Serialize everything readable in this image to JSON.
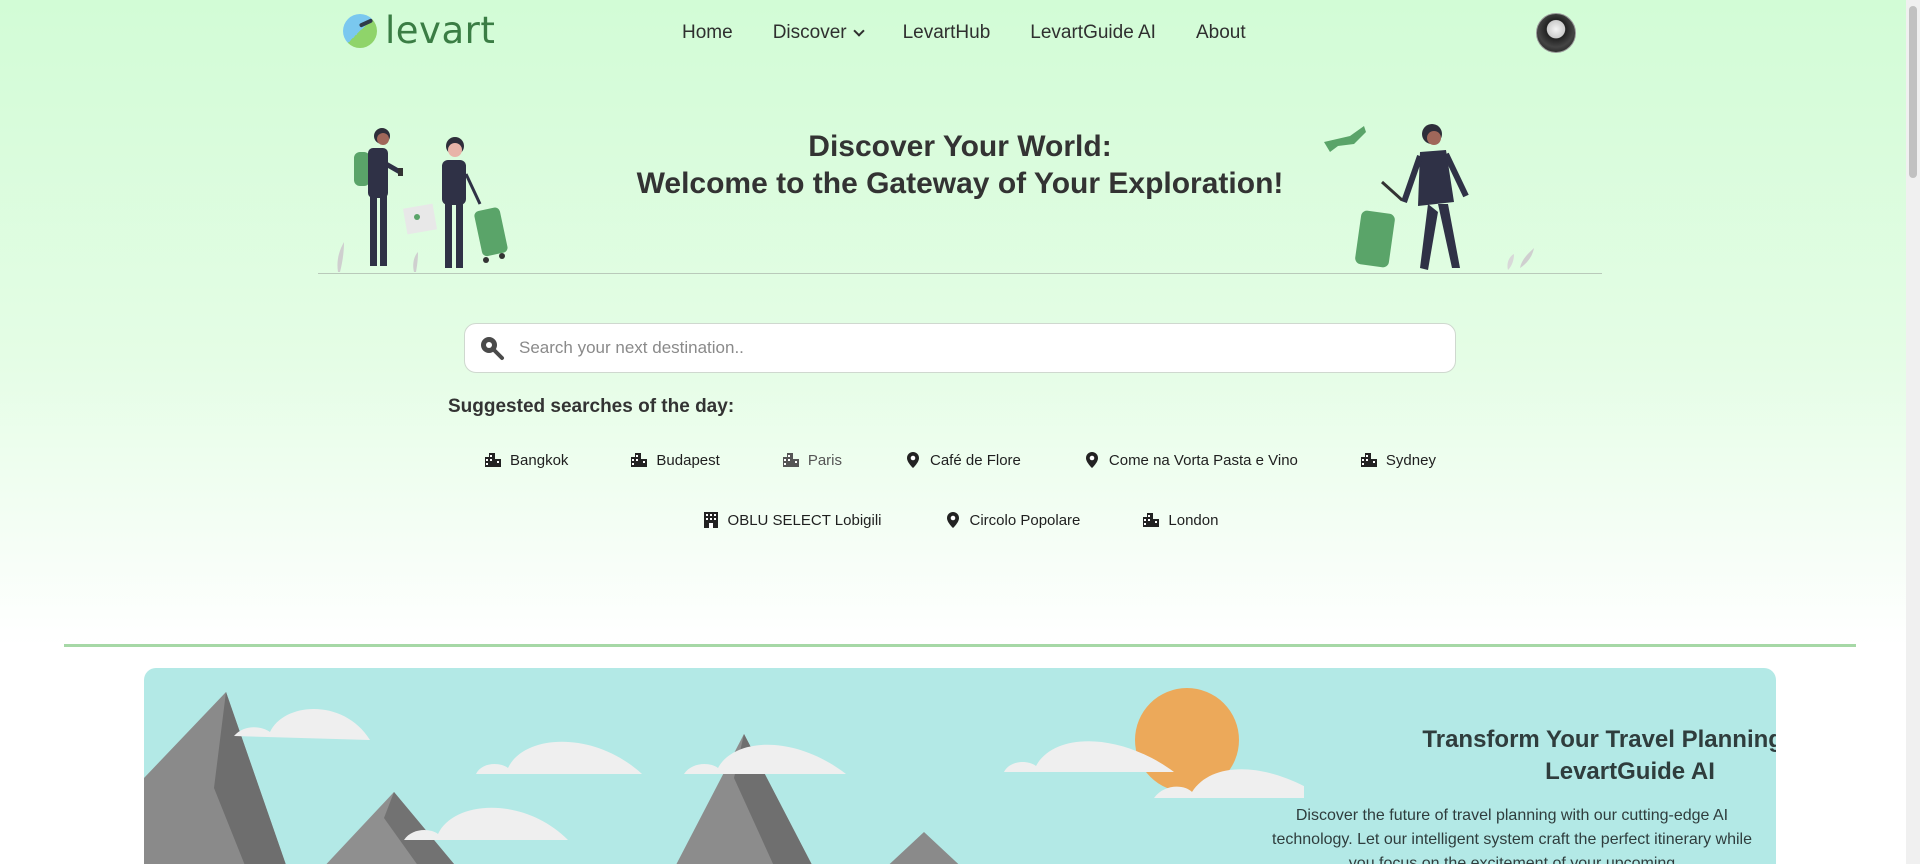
{
  "nav": {
    "logo_text": "levart",
    "links": [
      {
        "label": "Home"
      },
      {
        "label": "Discover"
      },
      {
        "label": "LevartHub"
      },
      {
        "label": "LevartGuide AI"
      },
      {
        "label": "About"
      }
    ]
  },
  "hero": {
    "title_line1": "Discover Your World:",
    "title_line2": "Welcome to the Gateway of Your Exploration!"
  },
  "search": {
    "placeholder": "Search your next destination..",
    "value": ""
  },
  "suggestions": {
    "title": "Suggested searches of the day:",
    "row1": [
      {
        "label": "Bangkok",
        "icon": "city-icon"
      },
      {
        "label": "Budapest",
        "icon": "city-icon"
      },
      {
        "label": "Paris",
        "icon": "city-icon"
      },
      {
        "label": "Café de Flore",
        "icon": "location-pin-icon"
      },
      {
        "label": "Come na Vorta Pasta e Vino",
        "icon": "location-pin-icon"
      },
      {
        "label": "Sydney",
        "icon": "city-icon"
      }
    ],
    "row2": [
      {
        "label": "OBLU SELECT Lobigili",
        "icon": "hotel-icon"
      },
      {
        "label": "Circolo Popolare",
        "icon": "location-pin-icon"
      },
      {
        "label": "London",
        "icon": "city-icon"
      }
    ]
  },
  "ai_banner": {
    "title": "Transform Your Travel Planning with LevartGuide AI",
    "text": "Discover the future of travel planning with our cutting-edge AI technology. Let our intelligent system craft the perfect itinerary while you focus on the excitement of your upcoming"
  },
  "colors": {
    "brand_green": "#3a7d44",
    "hero_bg": "#d2fcd6",
    "banner_bg": "#b3e9e6",
    "divider": "#a6d8a6"
  }
}
